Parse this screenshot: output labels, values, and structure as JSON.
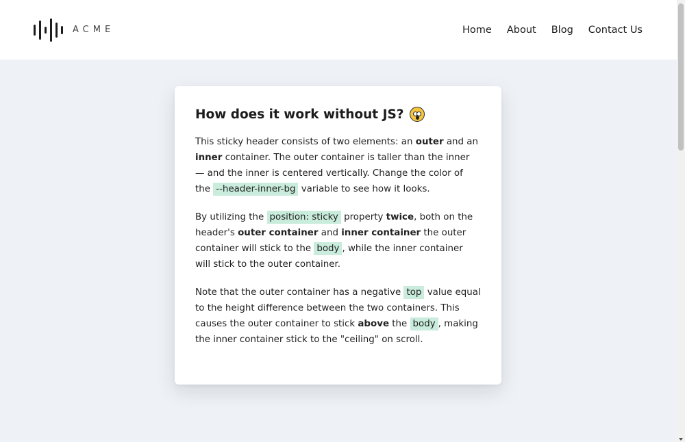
{
  "header": {
    "logo_text": "ACME",
    "nav": [
      "Home",
      "About",
      "Blog",
      "Contact Us"
    ]
  },
  "card": {
    "title": "How does it work without JS?",
    "emoji_icon": "astonished-face-emoji",
    "p1": {
      "t1": "This sticky header consists of two elements: an ",
      "b1": "outer",
      "t2": " and an ",
      "b2": "inner",
      "t3": " container. The outer container is taller than the inner — and the inner is centered vertically. Change the color of the ",
      "code1": "--header-inner-bg",
      "t4": " variable to see how it looks."
    },
    "p2": {
      "t1": "By utilizing the ",
      "code1": "position: sticky",
      "t2": " property ",
      "b1": "twice",
      "t3": ", both on the header's ",
      "b2": "outer container",
      "t4": " and ",
      "b3": "inner container",
      "t5": " the outer container will stick to the ",
      "code2": "body",
      "t6": ", while the inner container will stick to the outer container."
    },
    "p3": {
      "t1": "Note that the outer container has a negative ",
      "code1": "top",
      "t2": " value equal to the height difference between the two containers. This causes the outer container to stick ",
      "b1": "above",
      "t3": " the ",
      "code2": "body",
      "t4": ", making the inner container stick to the \"ceiling\" on scroll."
    }
  },
  "colors": {
    "page_bg": "#eef1f5",
    "code_bg": "#c9ecdc",
    "text": "#1c1c1c"
  }
}
